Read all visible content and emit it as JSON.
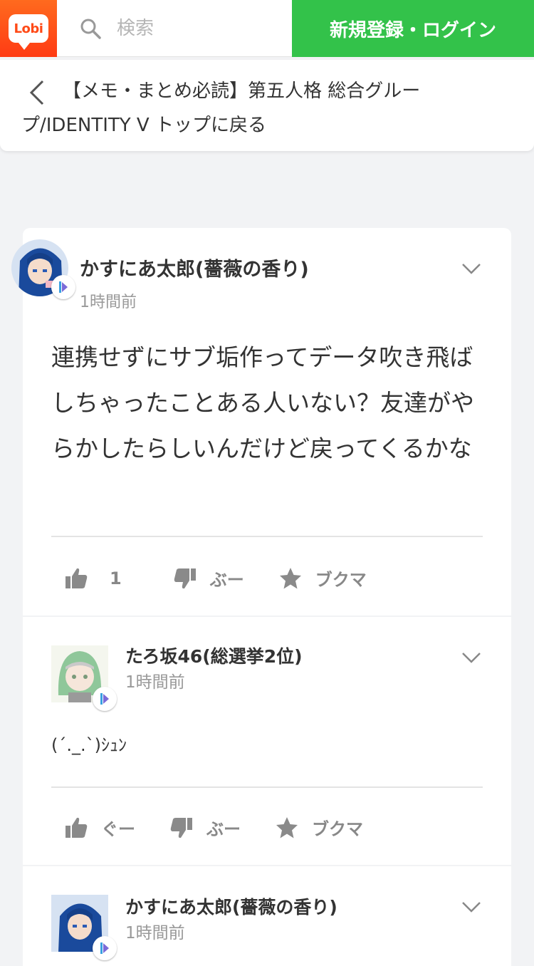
{
  "header": {
    "logo_text": "Lobi",
    "search_placeholder": "検索",
    "login_label": "新規登録・ログイン",
    "brand_color": "#ff4a17",
    "accent_color": "#33c24a"
  },
  "back": {
    "label": "【メモ・まとめ必読】第五人格 総合グループ/IDENTITY V トップに戻る"
  },
  "posts": [
    {
      "username": "かすにあ太郎(薔薇の香り)",
      "time": "1時間前",
      "body": "連携せずにサブ垢作ってデータ吹き飛ばしちゃったことある人いない？友達がやらかしたらしいんだけど戻ってくるかな",
      "like_label": "1",
      "dislike_label": "ぶー",
      "bookmark_label": "ブクマ"
    },
    {
      "username": "たろ坂46(総選挙2位)",
      "time": "1時間前",
      "body": "(´._.`)ｼｭﾝ",
      "like_label": "ぐー",
      "dislike_label": "ぶー",
      "bookmark_label": "ブクマ"
    },
    {
      "username": "かすにあ太郎(薔薇の香り)",
      "time": "1時間前"
    }
  ]
}
